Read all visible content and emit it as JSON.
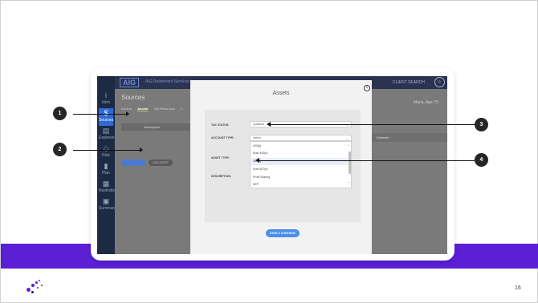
{
  "app": {
    "logo": "AIG",
    "subtitle": "AIG Retirement Services",
    "client_search": "CLIENT SEARCH",
    "page_title": "Sources",
    "client_name": "Maria, Age 75",
    "sidebar": [
      {
        "label": "Intro",
        "icon": "info-icon"
      },
      {
        "label": "Sources",
        "icon": "dollar-icon"
      },
      {
        "label": "Expenses",
        "icon": "document-icon"
      },
      {
        "label": "Risk",
        "icon": "shield-icon"
      },
      {
        "label": "Plan",
        "icon": "chart-icon"
      },
      {
        "label": "Illustrations",
        "icon": "grid-icon"
      },
      {
        "label": "Summary",
        "icon": "lock-icon"
      }
    ],
    "tabs": [
      "Income",
      "Assets",
      "OM Resources",
      "L"
    ],
    "table_header": "Description",
    "table_header_right": "Estimate",
    "gray_button": "ADD ASSET"
  },
  "modal": {
    "title": "Assets",
    "tax_status_label": "TAX STATUS:",
    "tax_status_value": "Qualified",
    "account_type_label": "ACCOUNT TYPE:",
    "account_type_value": "Select",
    "asset_type_label": "ASSET TYPE:",
    "description_label": "DESCRIPTION:",
    "dropdown_options": [
      "403(b)",
      "Roth 403(b)",
      "457(b)",
      "Roth 457(b)",
      "Profit Sharing",
      "SEP"
    ],
    "highlighted_option": "457(b)",
    "save_button": "SAVE & CONTINUE"
  },
  "markers": [
    "1",
    "2",
    "3",
    "4"
  ],
  "page_number": "16",
  "colors": {
    "accent": "#5b1fd6",
    "marker": "#262626",
    "sidebar": "#1d2a44",
    "primary_button": "#4a8fe8"
  }
}
